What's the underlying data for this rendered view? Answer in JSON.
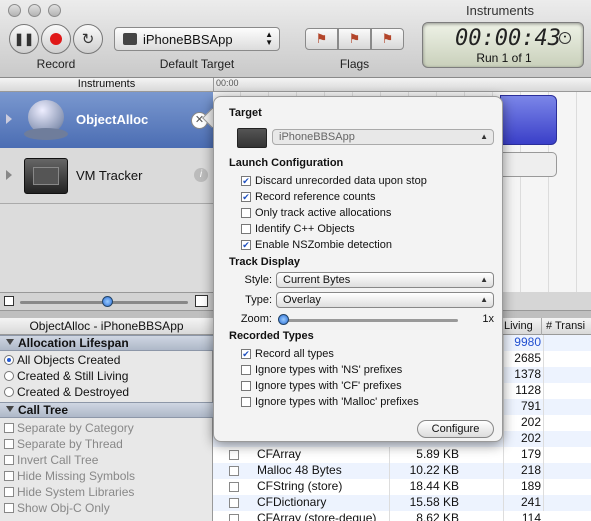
{
  "window": {
    "title": "Instruments"
  },
  "toolbar": {
    "record_label": "Record",
    "target_label": "Default Target",
    "target_value": "iPhoneBBSApp",
    "flags_label": "Flags",
    "timer": "00:00:43",
    "run": "Run 1 of 1"
  },
  "instruments": {
    "header": "Instruments",
    "ruler_start": "00:00",
    "items": [
      {
        "name": "ObjectAlloc"
      },
      {
        "name": "VM Tracker"
      }
    ]
  },
  "detail": {
    "title": "ObjectAlloc - iPhoneBBSApp",
    "allocation_lifespan": {
      "heading": "Allocation Lifespan",
      "options": [
        "All Objects Created",
        "Created & Still Living",
        "Created & Destroyed"
      ]
    },
    "call_tree": {
      "heading": "Call Tree",
      "options": [
        "Separate by Category",
        "Separate by Thread",
        "Invert Call Tree",
        "Hide Missing Symbols",
        "Hide System Libraries",
        "Show Obj-C Only"
      ]
    }
  },
  "table": {
    "headers": {
      "living": "Living",
      "transient": "# Transi"
    },
    "living_values": [
      "9980",
      "2685",
      "1378",
      "1128",
      "791",
      "202",
      "202"
    ],
    "rows": [
      {
        "category": "CFArray",
        "bytes": "5.89 KB",
        "living": "179"
      },
      {
        "category": "Malloc 48 Bytes",
        "bytes": "10.22 KB",
        "living": "218"
      },
      {
        "category": "CFString (store)",
        "bytes": "18.44 KB",
        "living": "189"
      },
      {
        "category": "CFDictionary",
        "bytes": "15.58 KB",
        "living": "241"
      },
      {
        "category": "CFArray (store-deque)",
        "bytes": "8.62 KB",
        "living": "114"
      }
    ]
  },
  "popover": {
    "target_heading": "Target",
    "target_value": "iPhoneBBSApp",
    "launch_heading": "Launch Configuration",
    "launch_options": [
      {
        "label": "Discard unrecorded data upon stop",
        "checked": true
      },
      {
        "label": "Record reference counts",
        "checked": true
      },
      {
        "label": "Only track active allocations",
        "checked": false
      },
      {
        "label": "Identify C++ Objects",
        "checked": false
      },
      {
        "label": "Enable NSZombie detection",
        "checked": true
      }
    ],
    "track_heading": "Track Display",
    "style_label": "Style:",
    "style_value": "Current Bytes",
    "type_label": "Type:",
    "type_value": "Overlay",
    "zoom_label": "Zoom:",
    "zoom_value": "1x",
    "recorded_heading": "Recorded Types",
    "recorded_options": [
      {
        "label": "Record all types",
        "checked": true
      },
      {
        "label": "Ignore types with 'NS' prefixes",
        "checked": false
      },
      {
        "label": "Ignore types with 'CF' prefixes",
        "checked": false
      },
      {
        "label": "Ignore types with 'Malloc' prefixes",
        "checked": false
      }
    ],
    "configure_label": "Configure"
  },
  "colors": {
    "accent": "#245ad3",
    "selected_row": "#5a7bc0",
    "track_bar": "#4a4fd6"
  }
}
